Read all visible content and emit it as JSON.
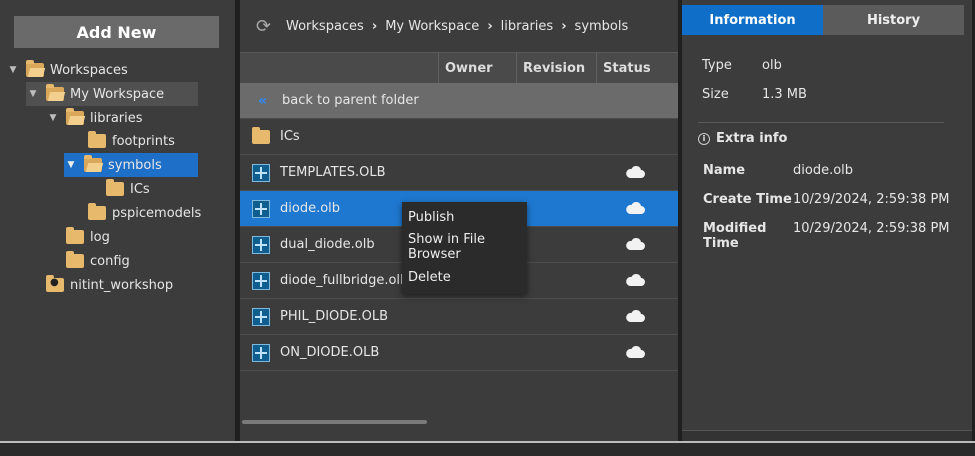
{
  "left": {
    "add_new_label": "Add New",
    "tree": [
      {
        "label": "Workspaces",
        "depth": 0,
        "expanded": true
      },
      {
        "label": "My Workspace",
        "depth": 1,
        "expanded": true,
        "hover": true
      },
      {
        "label": "libraries",
        "depth": 2,
        "expanded": true
      },
      {
        "label": "footprints",
        "depth": 3
      },
      {
        "label": "symbols",
        "depth": 3,
        "selected": true,
        "expanded": true
      },
      {
        "label": "ICs",
        "depth": 4
      },
      {
        "label": "pspicemodels",
        "depth": 3
      },
      {
        "label": "log",
        "depth": 2
      },
      {
        "label": "config",
        "depth": 2
      },
      {
        "label": "nitint_workshop",
        "depth": 1,
        "user": true
      }
    ]
  },
  "center": {
    "breadcrumb": [
      "Workspaces",
      "My Workspace",
      "libraries",
      "symbols"
    ],
    "columns": {
      "owner": "Owner",
      "revision": "Revision",
      "status": "Status"
    },
    "back_label": "back to parent folder",
    "folder_row": "ICs",
    "files": [
      {
        "name": "TEMPLATES.OLB",
        "status": "cloud"
      },
      {
        "name": "diode.olb",
        "status": "cloud",
        "selected": true
      },
      {
        "name": "dual_diode.olb",
        "status": "cloud"
      },
      {
        "name": "diode_fullbridge.olb",
        "status": "cloud"
      },
      {
        "name": "PHIL_DIODE.OLB",
        "status": "cloud"
      },
      {
        "name": "ON_DIODE.OLB",
        "status": "cloud"
      }
    ],
    "context_menu": [
      "Publish",
      "Show in File Browser",
      "Delete"
    ]
  },
  "right": {
    "tabs": {
      "information": "Information",
      "history": "History"
    },
    "type_label": "Type",
    "type_value": "olb",
    "size_label": "Size",
    "size_value": "1.3 MB",
    "extra_info_title": "Extra info",
    "name_label": "Name",
    "name_value": "diode.olb",
    "create_label": "Create Time",
    "create_value": "10/29/2024, 2:59:38 PM",
    "modified_label": "Modified Time",
    "modified_value": "10/29/2024, 2:59:38 PM"
  },
  "colors": {
    "accent": "#1e78d0",
    "panel": "#3c3c3c",
    "folder": "#e6b96d"
  }
}
